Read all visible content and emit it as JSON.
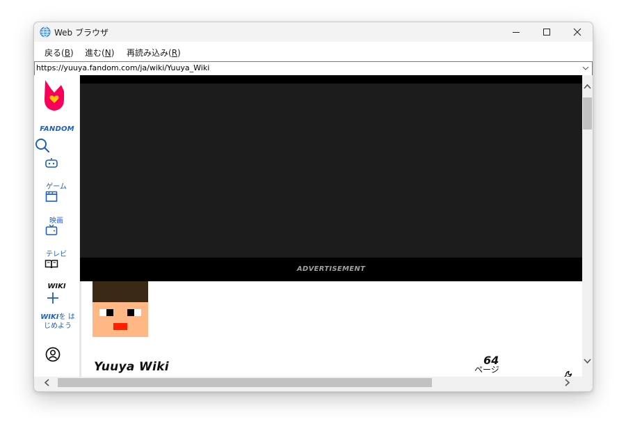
{
  "window": {
    "title": "Web ブラウザ"
  },
  "menu": {
    "back": {
      "label": "戻る",
      "key_open": "(",
      "key": "B",
      "key_close": ")"
    },
    "forward": {
      "label": "進む",
      "key_open": "(",
      "key": "N",
      "key_close": ")"
    },
    "reload": {
      "label": "再読み込み",
      "key_open": "(",
      "key": "R",
      "key_close": ")"
    }
  },
  "address": {
    "url": "https://yuuya.fandom.com/ja/wiki/Yuuya_Wiki"
  },
  "sidebar": {
    "brand": "FANDOM",
    "games_label": "ゲーム",
    "movies_label": "映画",
    "tv_label": "テレビ",
    "wiki_label": "WIKI",
    "start_wiki_bold": "WIKI",
    "start_wiki_rest1": "を は",
    "start_wiki_rest2": "じめよう"
  },
  "ad": {
    "label": "ADVERTISEMENT"
  },
  "wiki": {
    "title": "Yuuya Wiki",
    "page_count": "64",
    "page_unit": "ページ"
  },
  "colors": {
    "fandom_pink": "#FA005A",
    "fandom_yellow": "#FFC500",
    "link_blue": "#1d5fbf",
    "ad_background": "#1c1c1c"
  },
  "icons": {
    "app": "globe-icon",
    "minimize": "minimize-icon",
    "maximize": "maximize-icon",
    "close": "close-icon",
    "search": "search-icon",
    "controller": "game-controller-icon",
    "clapper": "clapperboard-icon",
    "tv": "tv-icon",
    "book": "book-icon",
    "plus": "plus-icon",
    "user": "user-circle-icon",
    "discussions": "discussions-icon",
    "theme": "theme-toggle-icon",
    "wrench": "wrench-icon"
  }
}
